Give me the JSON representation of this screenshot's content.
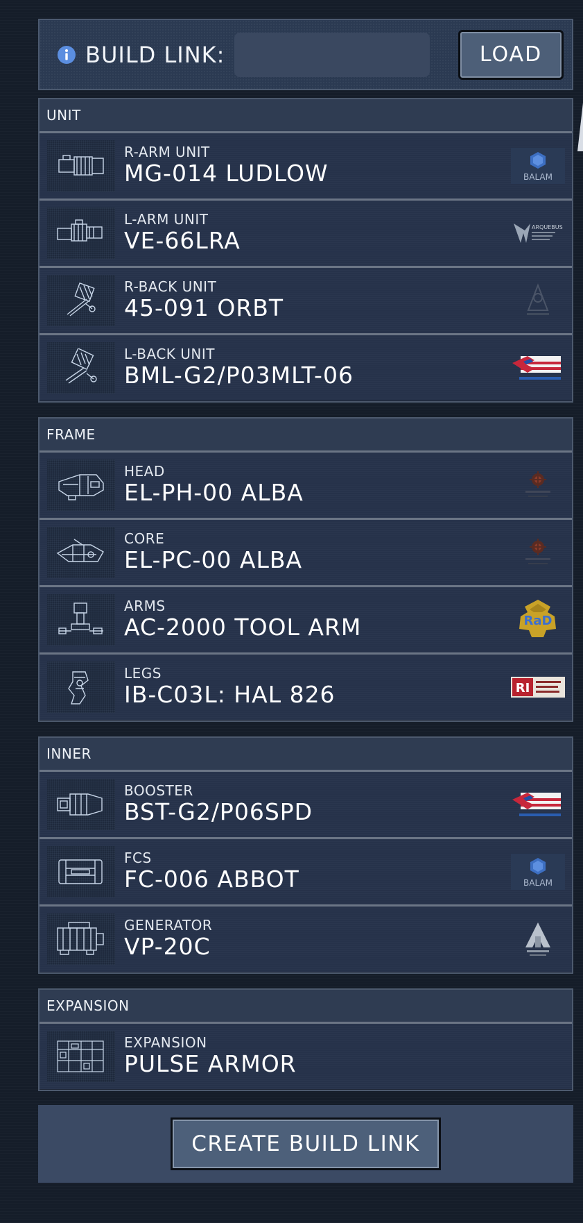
{
  "build_link": {
    "label": "BUILD LINK:",
    "input_value": "",
    "load_label": "LOAD",
    "info_icon": "info-icon"
  },
  "sections": [
    {
      "title": "UNIT",
      "parts": [
        {
          "slot": "R-ARM UNIT",
          "name": "MG-014 LUDLOW",
          "thumb_icon": "gatling-arm-icon",
          "maker_icon": "balam-logo-icon",
          "maker_text": "BALAM"
        },
        {
          "slot": "L-ARM UNIT",
          "name": "VE-66LRA",
          "thumb_icon": "rifle-arm-icon",
          "maker_icon": "arquebus-add-logo-icon",
          "maker_text": "ARQUEBUS"
        },
        {
          "slot": "R-BACK UNIT",
          "name": "45-091 ORBT",
          "thumb_icon": "orbit-launcher-icon",
          "maker_icon": "allmind-logo-icon",
          "maker_text": ""
        },
        {
          "slot": "L-BACK UNIT",
          "name": "BML-G2/P03MLT-06",
          "thumb_icon": "missile-launcher-icon",
          "maker_icon": "furlong-dynamics-logo-icon",
          "maker_text": ""
        }
      ]
    },
    {
      "title": "FRAME",
      "parts": [
        {
          "slot": "HEAD",
          "name": "EL-PH-00 ALBA",
          "thumb_icon": "head-part-icon",
          "maker_icon": "elcano-logo-icon",
          "maker_text": ""
        },
        {
          "slot": "CORE",
          "name": "EL-PC-00 ALBA",
          "thumb_icon": "core-part-icon",
          "maker_icon": "elcano-logo-icon",
          "maker_text": ""
        },
        {
          "slot": "ARMS",
          "name": "AC-2000 TOOL ARM",
          "thumb_icon": "arms-part-icon",
          "maker_icon": "rad-logo-icon",
          "maker_text": "RaD"
        },
        {
          "slot": "LEGS",
          "name": "IB-C03L: HAL 826",
          "thumb_icon": "legs-part-icon",
          "maker_icon": "rubicon-research-logo-icon",
          "maker_text": "RI"
        }
      ]
    },
    {
      "title": "INNER",
      "parts": [
        {
          "slot": "BOOSTER",
          "name": "BST-G2/P06SPD",
          "thumb_icon": "booster-part-icon",
          "maker_icon": "furlong-dynamics-logo-icon",
          "maker_text": ""
        },
        {
          "slot": "FCS",
          "name": "FC-006 ABBOT",
          "thumb_icon": "fcs-part-icon",
          "maker_icon": "balam-logo-icon",
          "maker_text": "BALAM"
        },
        {
          "slot": "GENERATOR",
          "name": "VP-20C",
          "thumb_icon": "generator-part-icon",
          "maker_icon": "arquebus-corp-logo-icon",
          "maker_text": ""
        }
      ]
    },
    {
      "title": "EXPANSION",
      "parts": [
        {
          "slot": "EXPANSION",
          "name": "PULSE ARMOR",
          "thumb_icon": "expansion-part-icon",
          "maker_icon": "",
          "maker_text": ""
        }
      ]
    }
  ],
  "footer": {
    "create_label": "CREATE BUILD LINK"
  },
  "colors": {
    "background": "#151d29",
    "panel": "#26324a",
    "section_header": "#2f3c52",
    "button": "#4d607a",
    "accent_blue": "#4a7fd0",
    "divider": "#6b7585"
  }
}
